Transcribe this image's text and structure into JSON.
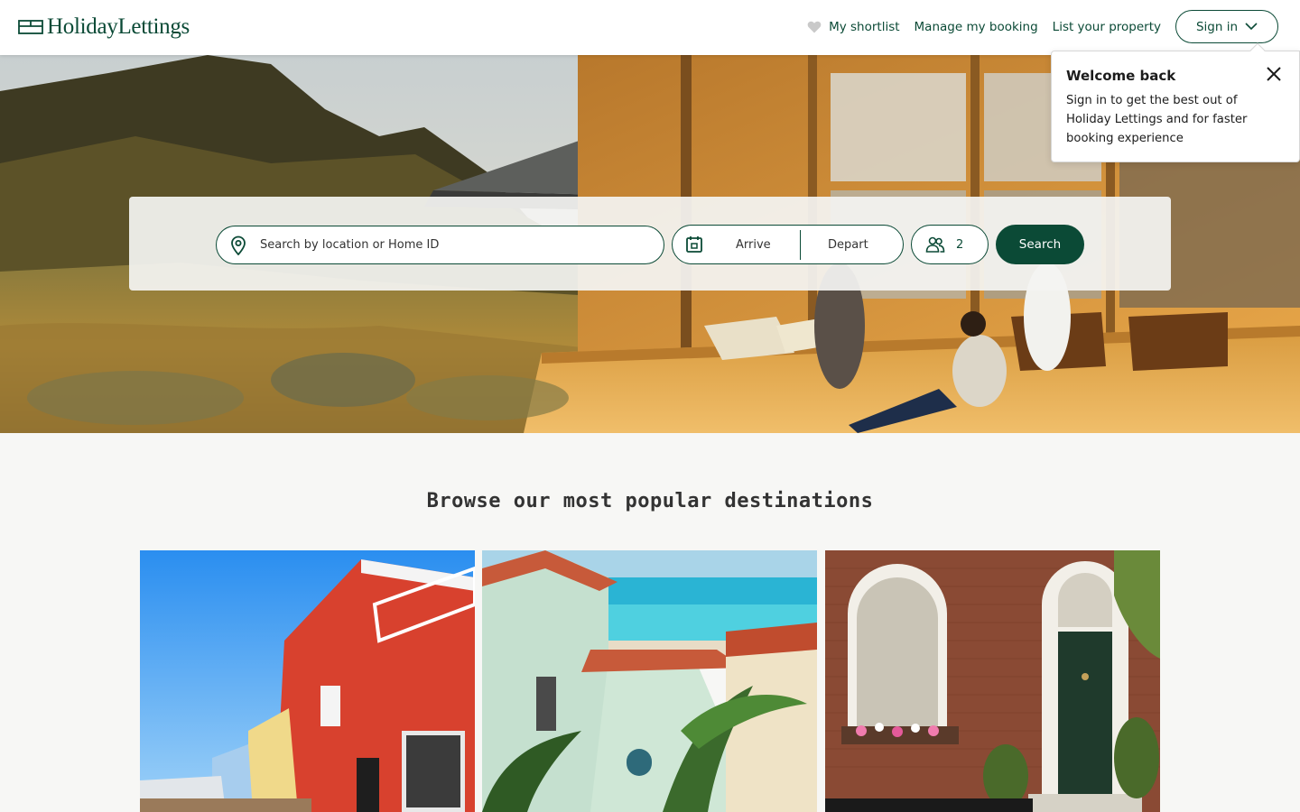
{
  "header": {
    "logo_text": "HolidayLettings",
    "nav": {
      "shortlist": "My shortlist",
      "manage_booking": "Manage my booking",
      "list_property": "List your property",
      "sign_in": "Sign in"
    }
  },
  "popover": {
    "title": "Welcome back",
    "body": "Sign in to get the best out of Holiday Lettings and for faster booking experience"
  },
  "search": {
    "location_placeholder": "Search by location or Home ID",
    "arrive_label": "Arrive",
    "depart_label": "Depart",
    "guests_count": "2",
    "search_button": "Search"
  },
  "browse": {
    "title": "Browse our most popular destinations",
    "cards": [
      {
        "image": "harbour-boardwalk-photo"
      },
      {
        "image": "beach-villa-photo"
      },
      {
        "image": "brick-townhouse-photo"
      }
    ]
  },
  "colors": {
    "brand_green": "#0b4a36",
    "page_background": "#f7f7f5"
  }
}
